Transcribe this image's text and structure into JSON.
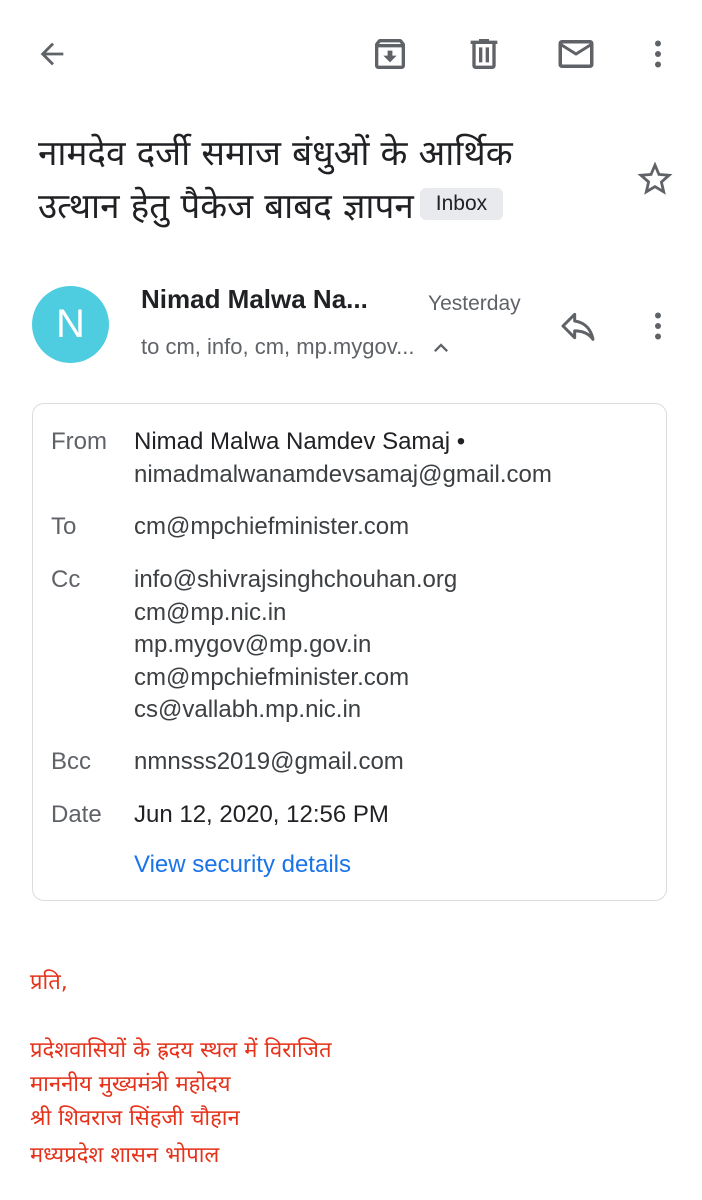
{
  "toolbar": {
    "icons": [
      "arrow-back-icon",
      "archive-icon",
      "delete-icon",
      "mark-unread-icon",
      "more-vert-icon"
    ]
  },
  "email": {
    "subject_line1": "नामदेव दर्जी समाज बंधुओं के आर्थिक",
    "subject_line2": "उत्थान हेतु पैकेज बाबद ज्ञापन",
    "label": "Inbox",
    "avatar_letter": "N",
    "avatar_color": "#4ecde0",
    "sender": "Nimad Malwa Na...",
    "time": "Yesterday",
    "recipients_summary": "to cm, info, cm, mp.mygov..."
  },
  "details": {
    "from_label": "From",
    "from_name": "Nimad Malwa Namdev Samaj •",
    "from_email": "nimadmalwanamdevsamaj@gmail.com",
    "to_label": "To",
    "to_value": "cm@mpchiefminister.com",
    "cc_label": "Cc",
    "cc_values": [
      "info@shivrajsinghchouhan.org",
      "cm@mp.nic.in",
      "mp.mygov@mp.gov.in",
      "cm@mpchiefminister.com",
      "cs@vallabh.mp.nic.in"
    ],
    "bcc_label": "Bcc",
    "bcc_value": "nmnsss2019@gmail.com",
    "date_label": "Date",
    "date_value": "Jun 12, 2020, 12:56 PM",
    "security_link": "View security details"
  },
  "body": {
    "color": "#e5321b",
    "line1": "प्रति,",
    "line2": "प्रदेशवासियों के ह्रदय स्थल में विराजित",
    "line3": "माननीय मुख्यमंत्री महोदय",
    "line4": "श्री शिवराज सिंहजी चौहान",
    "line5": "मध्यप्रदेश शासन भोपाल"
  }
}
